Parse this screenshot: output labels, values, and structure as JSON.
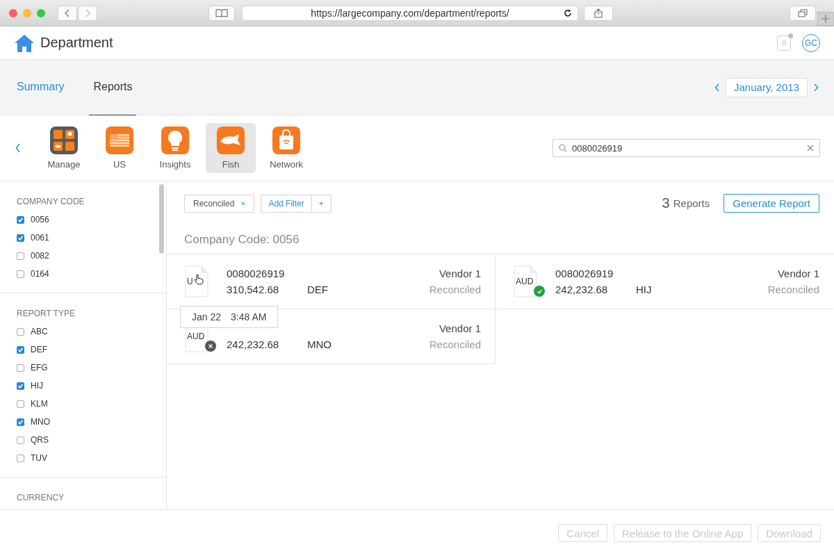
{
  "browser": {
    "url": "https://largecompany.com/department/reports/"
  },
  "header": {
    "title": "Department",
    "notifications": "0",
    "avatar": "GC"
  },
  "tabs": [
    {
      "label": "Summary",
      "selected": false
    },
    {
      "label": "Reports",
      "selected": true
    }
  ],
  "period": {
    "label": "January, 2013"
  },
  "apps": [
    {
      "kind": "grid",
      "label": "Manage",
      "selected": false
    },
    {
      "kind": "flag",
      "label": "US",
      "selected": false
    },
    {
      "kind": "bulb",
      "label": "Insights",
      "selected": false
    },
    {
      "kind": "fish",
      "label": "Fish",
      "selected": true
    },
    {
      "kind": "bag",
      "label": "Network",
      "selected": false
    }
  ],
  "search": {
    "value": "0080026919"
  },
  "sidebar": [
    {
      "title": "COMPANY CODE",
      "items": [
        {
          "label": "0056",
          "checked": true
        },
        {
          "label": "0061",
          "checked": true
        },
        {
          "label": "0082",
          "checked": false
        },
        {
          "label": "0164",
          "checked": false
        }
      ]
    },
    {
      "title": "REPORT TYPE",
      "items": [
        {
          "label": "ABC",
          "checked": false
        },
        {
          "label": "DEF",
          "checked": true
        },
        {
          "label": "EFG",
          "checked": false
        },
        {
          "label": "HIJ",
          "checked": true
        },
        {
          "label": "KLM",
          "checked": false
        },
        {
          "label": "MNO",
          "checked": true
        },
        {
          "label": "QRS",
          "checked": false
        },
        {
          "label": "TUV",
          "checked": false
        }
      ]
    },
    {
      "title": "CURRENCY"
    }
  ],
  "filters": {
    "chips": [
      "Reconciled"
    ],
    "add_label": "Add Filter",
    "add_icon": "+"
  },
  "summary": {
    "count": "3",
    "unit": "Reports",
    "action": "Generate Report"
  },
  "group_title": "Company Code: 0056",
  "reports": [
    {
      "currency": "U",
      "kind": "plain",
      "cursor": true,
      "id": "0080026919",
      "amount": "310,542.68",
      "type": "DEF",
      "vendor": "Vendor 1",
      "status": "Reconciled"
    },
    {
      "currency": "AUD",
      "kind": "ok",
      "cursor": false,
      "id": "0080026919",
      "amount": "242,232.68",
      "type": "HIJ",
      "vendor": "Vendor 1",
      "status": "Reconciled"
    },
    {
      "currency": "AUD",
      "kind": "error",
      "cursor": false,
      "amount": "242,232.68",
      "type": "MNO",
      "vendor": "Vendor 1",
      "status": "Reconciled"
    }
  ],
  "tooltip": {
    "date": "Jan 22",
    "time": "3:48 AM"
  },
  "footer": [
    {
      "label": "Cancel",
      "disabled": true
    },
    {
      "label": "Release to the Online App",
      "disabled": true
    },
    {
      "label": "Download",
      "disabled": true
    }
  ]
}
